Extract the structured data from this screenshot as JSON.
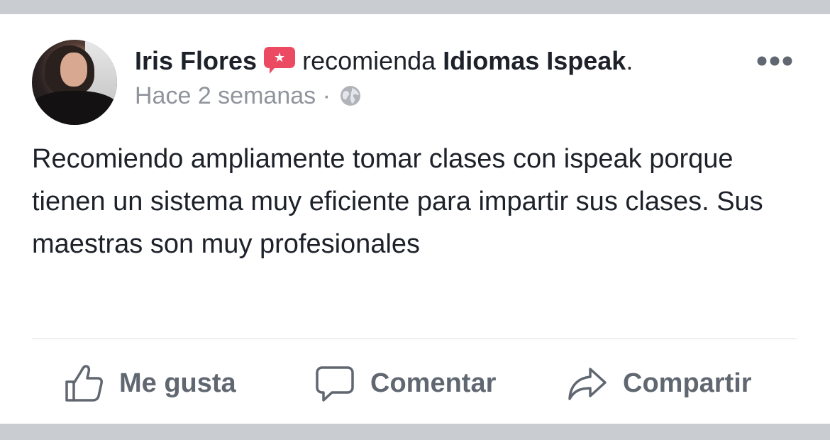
{
  "post": {
    "author": "Iris Flores",
    "verb": "recomienda",
    "page_name": "Idiomas Ispeak",
    "page_suffix": ".",
    "timestamp": "Hace 2 semanas",
    "separator": "·",
    "privacy_icon": "globe-icon",
    "recommend_icon": "recommendation-star-icon",
    "text": "Recomiendo ampliamente tomar clases con ispeak porque tienen un sistema muy eficiente para impartir sus clases. Sus maestras son muy profesionales"
  },
  "actions": {
    "like_label": "Me gusta",
    "comment_label": "Comentar",
    "share_label": "Compartir"
  },
  "colors": {
    "recommend_badge": "#ec4a62",
    "muted_text": "#90949c",
    "action_text": "#606770",
    "body_text": "#1d2129",
    "page_bg": "#c9ccd1"
  }
}
